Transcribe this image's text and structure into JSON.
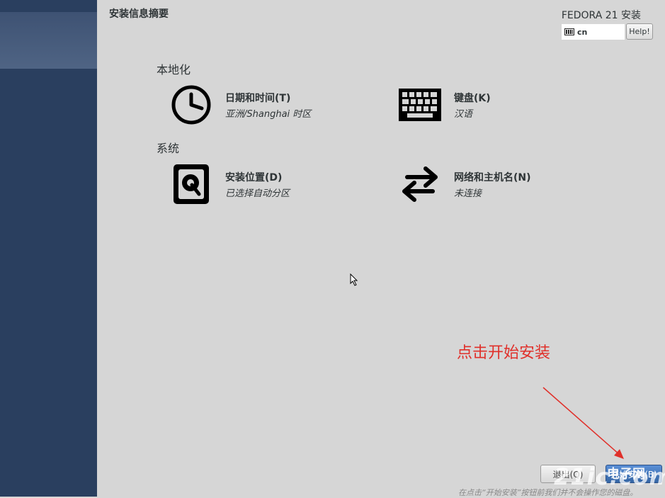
{
  "header": {
    "page_title": "安装信息摘要",
    "product_title": "FEDORA 21 安装",
    "keyboard_layout": "cn",
    "help_label": "Help!"
  },
  "sections": [
    {
      "heading": "本地化",
      "spokes": [
        {
          "title": "日期和时间(T)",
          "status": "亚洲/Shanghai 时区",
          "icon": "clock-icon"
        },
        {
          "title": "键盘(K)",
          "status": "汉语",
          "icon": "keyboard-icon"
        }
      ]
    },
    {
      "heading": "系统",
      "spokes": [
        {
          "title": "安装位置(D)",
          "status": "已选择自动分区",
          "icon": "harddisk-icon"
        },
        {
          "title": "网络和主机名(N)",
          "status": "未连接",
          "icon": "network-arrows-icon"
        }
      ]
    }
  ],
  "annotation": {
    "text": "点击开始安装",
    "color": "#e0302a"
  },
  "footer": {
    "quit_label": "退出(Q)",
    "begin_label": "开始安装(B)",
    "note": "在点击“开始安装”按钮前我们并不会操作您的磁盘。"
  },
  "watermark": {
    "text": "21ic.com",
    "text_cn": "电子网"
  },
  "colors": {
    "sidebar": "#2a3f5f",
    "background": "#d6d6d6",
    "accent": "#3465a4"
  }
}
